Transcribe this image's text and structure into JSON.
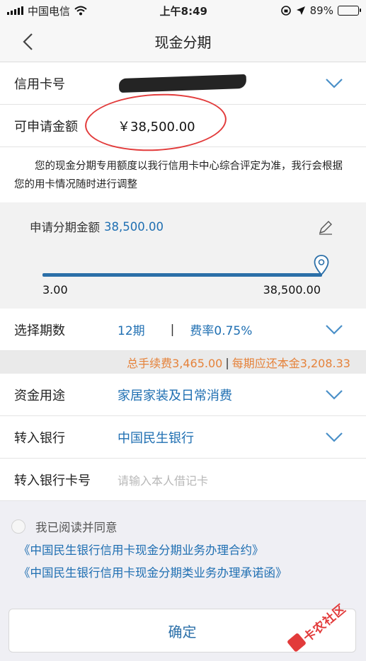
{
  "status_bar": {
    "carrier": "中国电信",
    "time": "上午8:49",
    "battery_percent": "89%",
    "battery_level": 0.89
  },
  "nav": {
    "title": "现金分期",
    "back_icon": "chevron-left-icon"
  },
  "card_row": {
    "label": "信用卡号",
    "icon": "chevron-down-icon"
  },
  "amount_row": {
    "label": "可申请金额",
    "value": "￥38,500.00"
  },
  "notice": {
    "text": "您的现金分期专用额度以我行信用卡中心综合评定为准，我行会根据您的用卡情况随时进行调整"
  },
  "slider": {
    "label": "申请分期金额",
    "value": "38,500.00",
    "min_label": "3.00",
    "max_label": "38,500.00",
    "level": 1.0,
    "edit_icon": "pencil-icon",
    "handle_icon": "map-pin-icon"
  },
  "period_row": {
    "label": "选择期数",
    "period": "12期",
    "separator": "|",
    "rate": "费率0.75%"
  },
  "fee_bar": {
    "total_fee": "总手续费3,465.00",
    "separator": "|",
    "per_period": "每期应还本金3,208.33"
  },
  "purpose_row": {
    "label": "资金用途",
    "value": "家居家装及日常消费"
  },
  "bank_row": {
    "label": "转入银行",
    "value": "中国民生银行"
  },
  "bank_card_row": {
    "label": "转入银行卡号",
    "placeholder": "请输入本人借记卡"
  },
  "agreement": {
    "checkbox_label": "我已阅读并同意",
    "contract_link": "《中国民生银行信用卡现金分期业务办理合约》",
    "promise_link": "《中国民生银行信用卡现金分期类业务办理承诺函》"
  },
  "confirm_button": {
    "label": "确定"
  },
  "watermark": {
    "text": "卡农社区"
  },
  "colors": {
    "accent_blue": "#1f6fb2",
    "fee_orange": "#e5823a",
    "annotation_red": "#e23b3b"
  }
}
